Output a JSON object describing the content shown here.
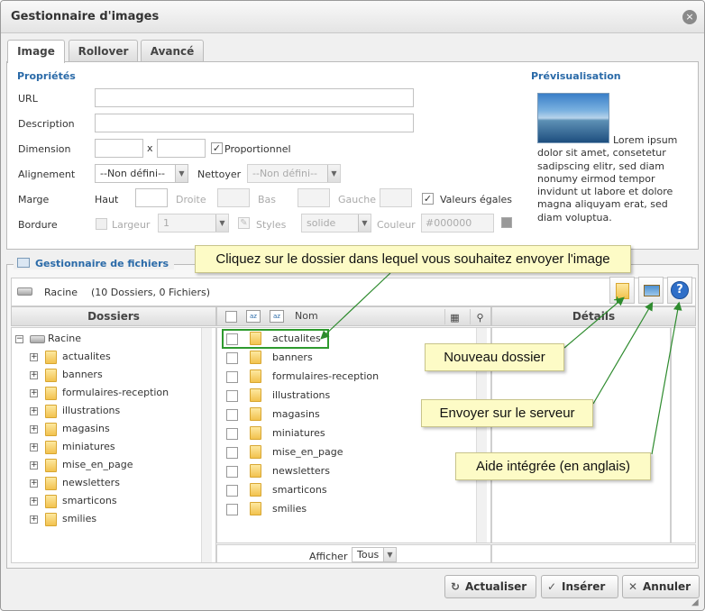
{
  "dialog": {
    "title": "Gestionnaire d'images",
    "close": "×"
  },
  "tabs": [
    {
      "label": "Image"
    },
    {
      "label": "Rollover"
    },
    {
      "label": "Avancé"
    }
  ],
  "properties": {
    "section": "Propriétés",
    "url_label": "URL",
    "description_label": "Description",
    "dimension_label": "Dimension",
    "dimension_sep": "x",
    "proportional_label": "Proportionnel",
    "proportional_checked": true,
    "alignment_label": "Alignement",
    "alignment_value": "--Non défini--",
    "wrap_label": "Nettoyer",
    "wrap_value": "--Non défini--",
    "margin_label": "Marge",
    "margin_top": "Haut",
    "margin_right": "Droite",
    "margin_bottom": "Bas",
    "margin_left": "Gauche",
    "equal_values_label": "Valeurs égales",
    "equal_values_checked": true,
    "border_label": "Bordure",
    "border_width_label": "Largeur",
    "border_width_value": "1",
    "border_style_label": "Styles",
    "border_style_value": "solide",
    "border_color_label": "Couleur",
    "border_color_value": "#000000"
  },
  "preview": {
    "section": "Prévisualisation",
    "lines": [
      "Lorem ipsum",
      "dolor sit amet, consetetur",
      "sadipscing elitr, sed diam",
      "nonumy eirmod tempor",
      "invidunt ut labore et dolore",
      "magna aliquyam erat, sed",
      "diam voluptua."
    ]
  },
  "file_manager": {
    "section": "Gestionnaire de fichiers",
    "root": "Racine",
    "summary": "(10 Dossiers, 0 Fichiers)",
    "folders_header": "Dossiers",
    "details_header": "Détails",
    "name_header": "Nom",
    "tree_root": "Racine",
    "folders": [
      "actualites",
      "banners",
      "formulaires-reception",
      "illustrations",
      "magasins",
      "miniatures",
      "mise_en_page",
      "newsletters",
      "smarticons",
      "smilies"
    ],
    "show_label": "Afficher",
    "show_value": "Tous"
  },
  "buttons": {
    "refresh": "Actualiser",
    "insert": "Insérer",
    "cancel": "Annuler"
  },
  "icons": {
    "refresh": "refresh-icon",
    "insert": "check-icon",
    "cancel": "close-icon",
    "new_folder": "new-folder-icon",
    "upload": "upload-icon",
    "help": "help-icon"
  },
  "tooltips": {
    "click_folder": "Cliquez sur le dossier dans lequel vous souhaitez envoyer l'image",
    "new_folder": "Nouveau dossier",
    "upload": "Envoyer sur le serveur",
    "help": "Aide intégrée (en anglais)"
  },
  "colors": {
    "accent": "#2a6aa8",
    "tooltip_bg": "#fdfbc6",
    "arrow": "#2e8b2e"
  }
}
